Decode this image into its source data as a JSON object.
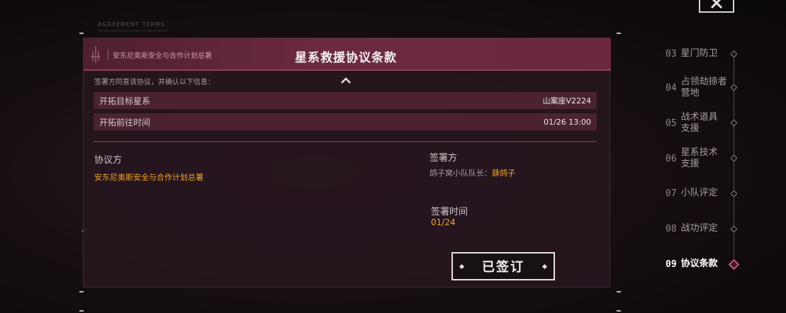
{
  "background": {
    "tab_label": "AGREEMENT TERMS"
  },
  "dialog": {
    "org_name": "安东尼奥斯安全与合作计划总署",
    "title": "星系救援协议条款",
    "intro": "签署方同意该协议，并确认以下信息：",
    "rows": [
      {
        "label": "开拓目标星系",
        "value": "山案座V2224"
      },
      {
        "label": "开拓前往时间",
        "value": "01/26 13:00"
      }
    ],
    "party_a": {
      "heading": "协议方",
      "name": "安东尼奥斯安全与合作计划总署"
    },
    "party_b": {
      "heading": "签署方",
      "signer_prefix": "鸽子窝小队队长：",
      "signer_name": "薛鸽子"
    },
    "sign_time": {
      "heading": "签署时间",
      "value": "01/24"
    },
    "signed_button": "已签订"
  },
  "steps": [
    {
      "num": "03",
      "label": "星门防卫",
      "active": false
    },
    {
      "num": "04",
      "label": "占领劫掠者营地",
      "line1": "占领劫掠者",
      "line2": "营地",
      "active": false
    },
    {
      "num": "05",
      "label": "战术道具支援",
      "line1": "战术道具",
      "line2": "支援",
      "active": false
    },
    {
      "num": "06",
      "label": "星系技术支援",
      "line1": "星系技术",
      "line2": "支援",
      "active": false
    },
    {
      "num": "07",
      "label": "小队评定",
      "active": false
    },
    {
      "num": "08",
      "label": "战功评定",
      "active": false
    },
    {
      "num": "09",
      "label": "协议条款",
      "active": true
    }
  ],
  "colors": {
    "accent": "#f2a42a",
    "header": "#6c2a42",
    "active_node": "#c2557a"
  }
}
